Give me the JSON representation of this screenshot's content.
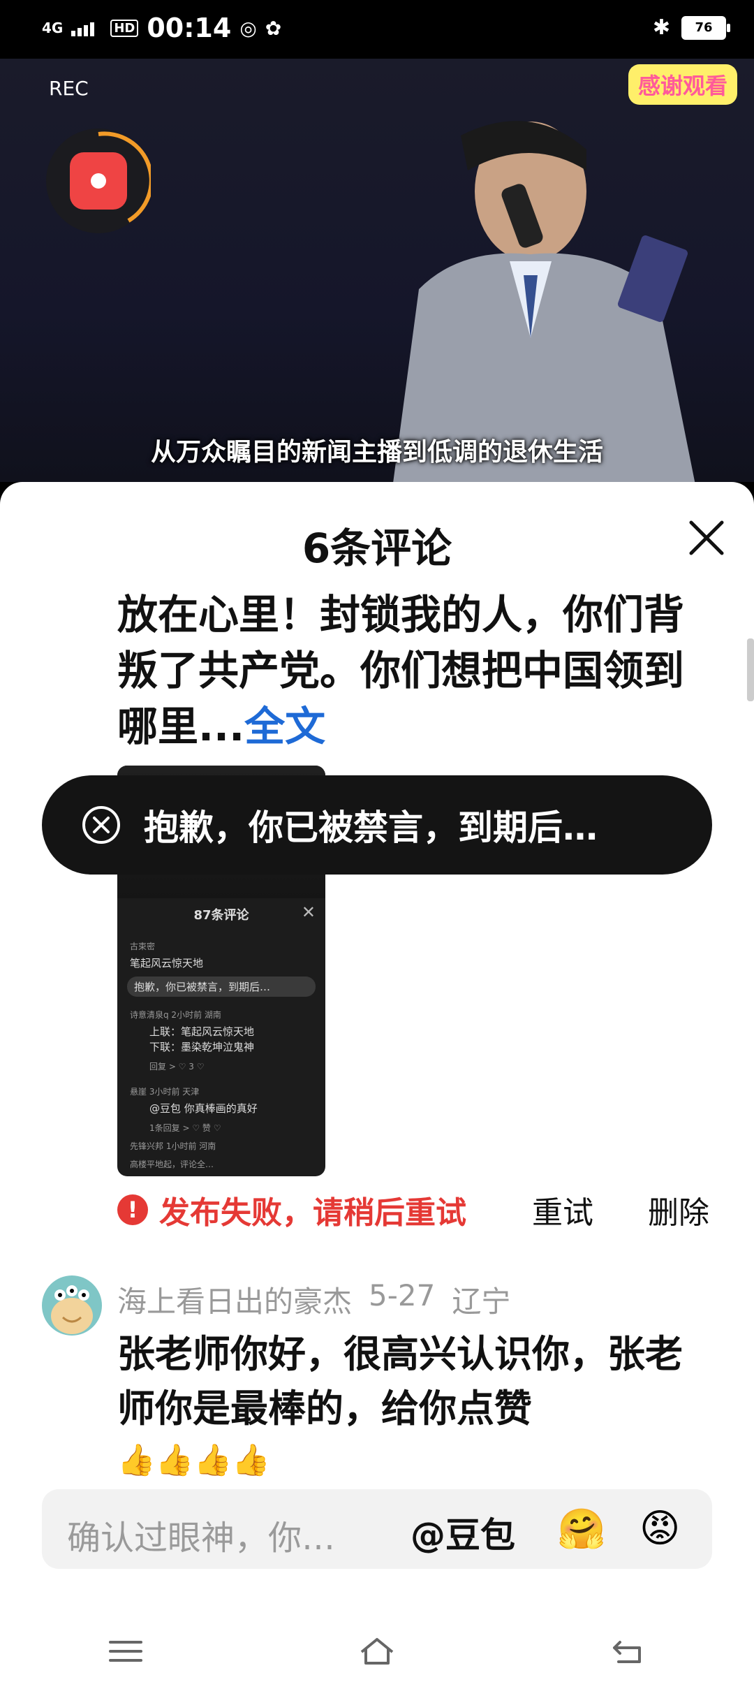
{
  "status_bar": {
    "network": "4G",
    "time": "00:14",
    "hd_label": "HD",
    "battery": "76",
    "icons": [
      "signal-icon",
      "hd-icon",
      "qq-icon",
      "wechat-icon",
      "bluetooth-icon",
      "battery-icon"
    ]
  },
  "video": {
    "rec_label": "REC",
    "thanks_sticker": "感谢观看",
    "subtitle": "从万众瞩目的新闻主播到低调的退休生活"
  },
  "sheet": {
    "title": "6条评论",
    "comment1_text": "放在心里！封锁我的人，你们背叛了共产党。你们想把中国领到哪里...",
    "comment1_more": "全文",
    "toast": "抱歉，你已被禁言，到期后…",
    "thumbnail": {
      "title": "87条评论",
      "lines": [
        {
          "text": "古束密",
          "small": true
        },
        {
          "text": "笔起风云惊天地",
          "small": false
        },
        {
          "text": "抱歉，你已被禁言，到期后…",
          "small": false
        },
        {
          "text": "诗意清泉q 2小时前 湖南",
          "small": true
        },
        {
          "text": "上联：笔起风云惊天地",
          "small": false
        },
        {
          "text": "下联：墨染乾坤泣鬼神",
          "small": false
        },
        {
          "text": "回复 >      ♡ 3   ♡",
          "small": true
        },
        {
          "text": "悬崖 3小时前 天津",
          "small": true
        },
        {
          "text": "@豆包 你真棒画的真好",
          "small": false
        },
        {
          "text": "1条回复 >     ♡ 赞  ♡",
          "small": true
        },
        {
          "text": "先锋兴邦 1小时前 河南",
          "small": true
        },
        {
          "text": "高楼平地起，评论全…",
          "small": true
        }
      ]
    },
    "fail_text": "发布失败，请稍后重试",
    "retry": "重试",
    "delete": "删除",
    "comment2": {
      "user": "海上看日出的豪杰",
      "date": "5-27",
      "region": "辽宁",
      "text": "张老师你好，很高兴认识你，张老师你是最棒的，给你点赞",
      "thumbs": "👍👍👍👍"
    },
    "input": {
      "placeholder": "确认过眼神，你…",
      "mention": "@豆包",
      "emoji1": "🤗",
      "emoji2": "😡"
    }
  }
}
